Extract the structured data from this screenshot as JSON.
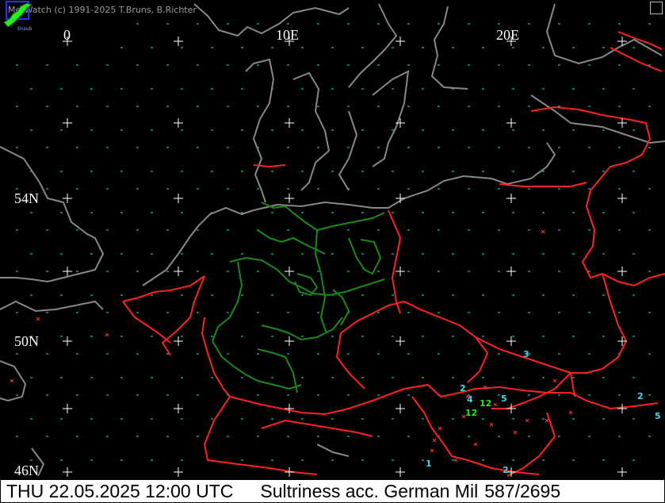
{
  "header": {
    "copyright": "MetWatch  (c) 1991-2025 T.Bruns, B.Richter"
  },
  "logo": {
    "icon": "metwatch-logo-icon",
    "text": "Ensub"
  },
  "grid_labels": {
    "lon_0": "0",
    "lon_10": "10E",
    "lon_20": "20E",
    "lat_54": "54N",
    "lat_50": "50N",
    "lat_46": "46N"
  },
  "footer": {
    "datetime": "THU 22.05.2025 12:00 UTC",
    "product": "Sultriness acc. German Mil",
    "counter": "587/2695"
  },
  "values": [
    {
      "v": "3",
      "c": "#33ddee"
    },
    {
      "v": "2",
      "c": "#33ddee"
    },
    {
      "v": "4",
      "c": "#33ddee"
    },
    {
      "v": "12",
      "c": "#22ee22"
    },
    {
      "v": "5",
      "c": "#33ddee"
    },
    {
      "v": "12",
      "c": "#22ee22"
    },
    {
      "v": "2",
      "c": "#33ddee"
    },
    {
      "v": "5",
      "c": "#33ddee"
    },
    {
      "v": "1",
      "c": "#33ddee"
    },
    {
      "v": "2",
      "c": "#33ddee"
    }
  ],
  "colors": {
    "coast": "#888888",
    "border": "#ff2222",
    "state_border": "#1a8a1a",
    "grid": "#ffffff",
    "dash": "#33dddd",
    "footer_bg": "#ffffff"
  }
}
